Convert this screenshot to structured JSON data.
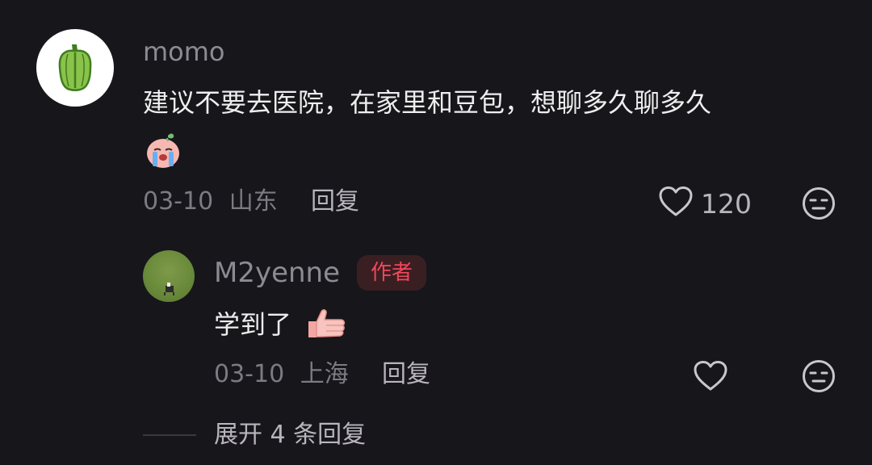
{
  "comment": {
    "username": "momo",
    "avatar_icon": "green-pepper-icon",
    "text": "建议不要去医院，在家里和豆包，想聊多久聊多久",
    "emoji_icon": "crying-peach-emoji-icon",
    "date": "03-10",
    "location": "山东",
    "reply_label": "回复",
    "like_count": "120",
    "like_icon": "heart-icon",
    "dislike_icon": "meh-face-icon"
  },
  "reply": {
    "username": "M2yenne",
    "author_badge": "作者",
    "text": "学到了",
    "emoji_icon": "thumbs-up-emoji-icon",
    "date": "03-10",
    "location": "上海",
    "reply_label": "回复",
    "like_icon": "heart-icon",
    "dislike_icon": "meh-face-icon"
  },
  "expand_replies": "展开 4 条回复",
  "colors": {
    "background": "#17161b",
    "author_badge_text": "#f0475a",
    "author_badge_bg": "#3a1f22",
    "avatar_pepper": "#8bc34a"
  }
}
